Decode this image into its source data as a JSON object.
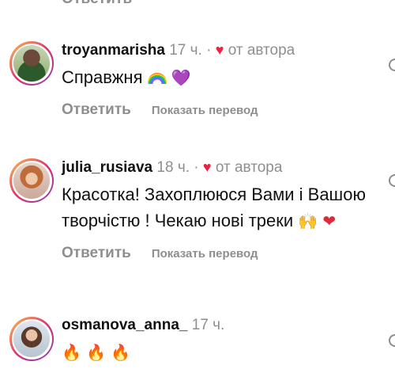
{
  "top_partial_reply": "Ответить",
  "colors": {
    "username": "#111111",
    "muted": "#8e8e8e",
    "heart": "#ed2140"
  },
  "comments": [
    {
      "username": "troyanmarisha",
      "time": "17 ч.",
      "dot": "·",
      "author_heart": "♥",
      "author_label": "от автора",
      "text": "Справжня",
      "emojis": [
        "rainbow",
        "💜"
      ],
      "reply_label": "Ответить",
      "translate_label": "Показать перевод"
    },
    {
      "username": "julia_rusiava",
      "time": "18 ч.",
      "dot": "·",
      "author_heart": "♥",
      "author_label": "от автора",
      "text": "Красотка! Захоплююся Вами і Вашою творчістю ! Чекаю нові треки",
      "emojis": [
        "🙌",
        "❤"
      ],
      "reply_label": "Ответить",
      "translate_label": "Показать перевод"
    },
    {
      "username": "osmanova_anna_",
      "time": "17 ч.",
      "emojis": [
        "🔥",
        "🔥",
        "🔥"
      ]
    }
  ]
}
